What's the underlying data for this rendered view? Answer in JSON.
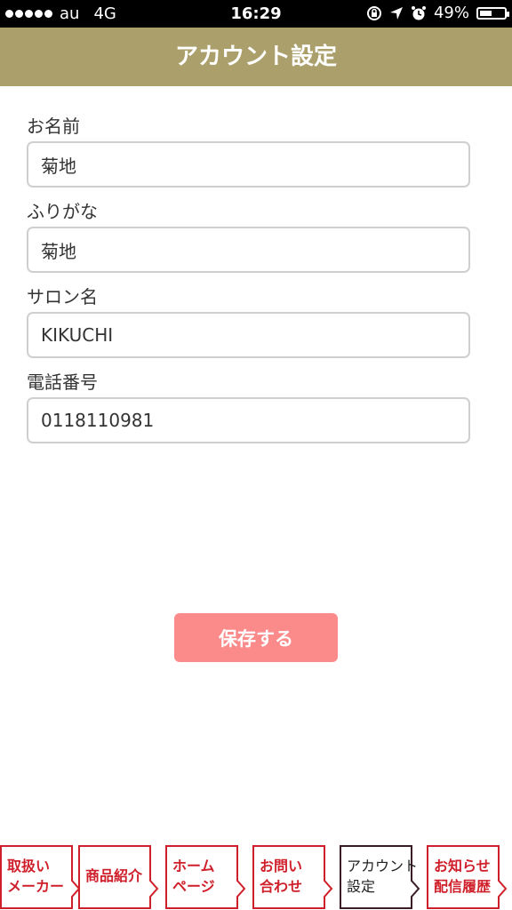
{
  "status_bar": {
    "carrier": "au",
    "network": "4G",
    "time": "16:29",
    "battery_text": "49%",
    "battery_level": 0.49,
    "icons": [
      "signal-dots-icon",
      "rotation-lock-icon",
      "location-arrow-icon",
      "alarm-icon",
      "battery-icon"
    ]
  },
  "header": {
    "title": "アカウント設定",
    "background": "#ab9f6b"
  },
  "form": {
    "fields": [
      {
        "label": "お名前",
        "value": "菊地"
      },
      {
        "label": "ふりがな",
        "value": "菊地"
      },
      {
        "label": "サロン名",
        "value": "KIKUCHI"
      },
      {
        "label": "電話番号",
        "value": "0118110981"
      }
    ]
  },
  "save_button": {
    "label": "保存する",
    "color": "#fb8a8a"
  },
  "tab_bar": {
    "accent": "#cf1f2a",
    "tabs": [
      {
        "line1": "取扱い",
        "line2": "メーカー",
        "active": false
      },
      {
        "line1": "商品紹介",
        "line2": "",
        "active": false
      },
      {
        "line1": "ホーム",
        "line2": "ページ",
        "active": false
      },
      {
        "line1": "お問い",
        "line2": "合わせ",
        "active": false
      },
      {
        "line1": "アカウント",
        "line2": "設定",
        "active": true
      },
      {
        "line1": "お知らせ",
        "line2": "配信履歴",
        "active": false
      }
    ]
  }
}
